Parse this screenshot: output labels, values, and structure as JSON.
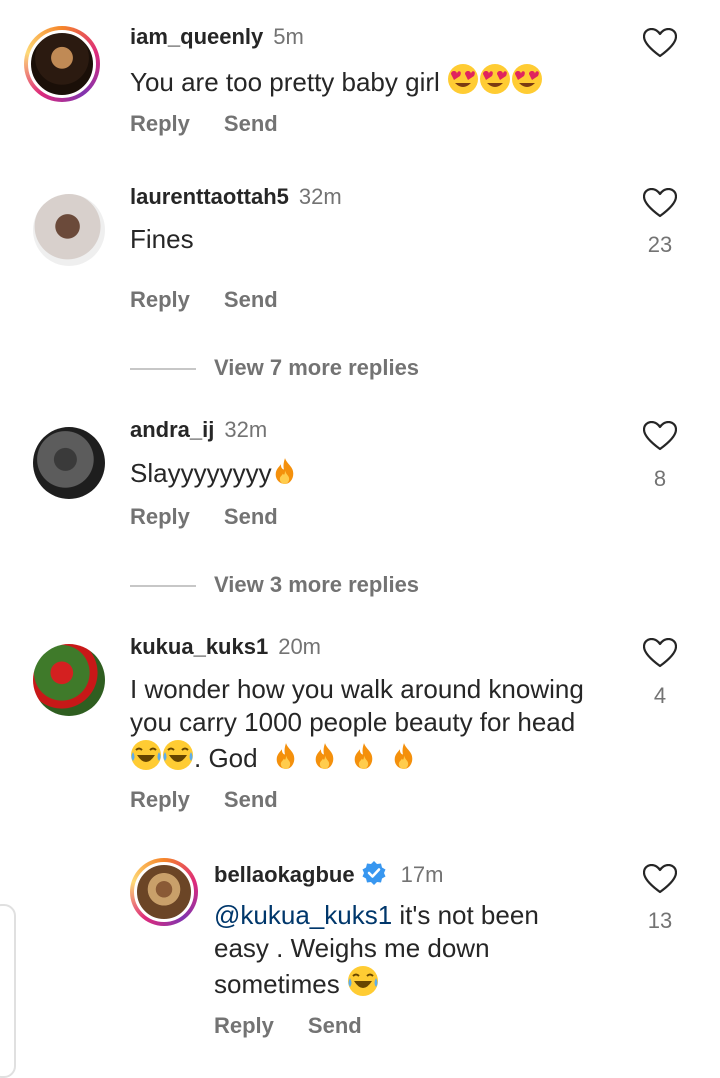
{
  "comments": [
    {
      "user": "iam_queenly",
      "time": "5m",
      "text": "You are too pretty baby girl",
      "reply": "Reply",
      "send": "Send",
      "likes": "",
      "emoji": "heart-eyes-face-icon"
    },
    {
      "user": "laurenttaottah5",
      "time": "32m",
      "text": "Fines",
      "reply": "Reply",
      "send": "Send",
      "likes": "23"
    },
    {
      "user": "andra_ij",
      "time": "32m",
      "text": "Slayyyyyyyy",
      "reply": "Reply",
      "send": "Send",
      "likes": "8",
      "emoji": "fire-icon"
    },
    {
      "user": "kukua_kuks1",
      "time": "20m",
      "text_line1": "I wonder how you walk around knowing",
      "text_line2": "you carry 1000 people beauty for head",
      "text_line3": ". God",
      "reply": "Reply",
      "send": "Send",
      "likes": "4"
    },
    {
      "user": "bellaokagbue",
      "time": "17m",
      "mention": "@kukua_kuks1",
      "text_line1": " it's not been",
      "text_line2": "easy . Weighs me down",
      "text_line3": "sometimes",
      "reply": "Reply",
      "send": "Send",
      "likes": "13",
      "verified": true
    }
  ],
  "view_more": [
    "View 7 more replies",
    "View 3 more replies"
  ],
  "colors": {
    "text": "#262626",
    "muted": "#737373",
    "verified": "#3897f0",
    "mention": "#00376b"
  }
}
